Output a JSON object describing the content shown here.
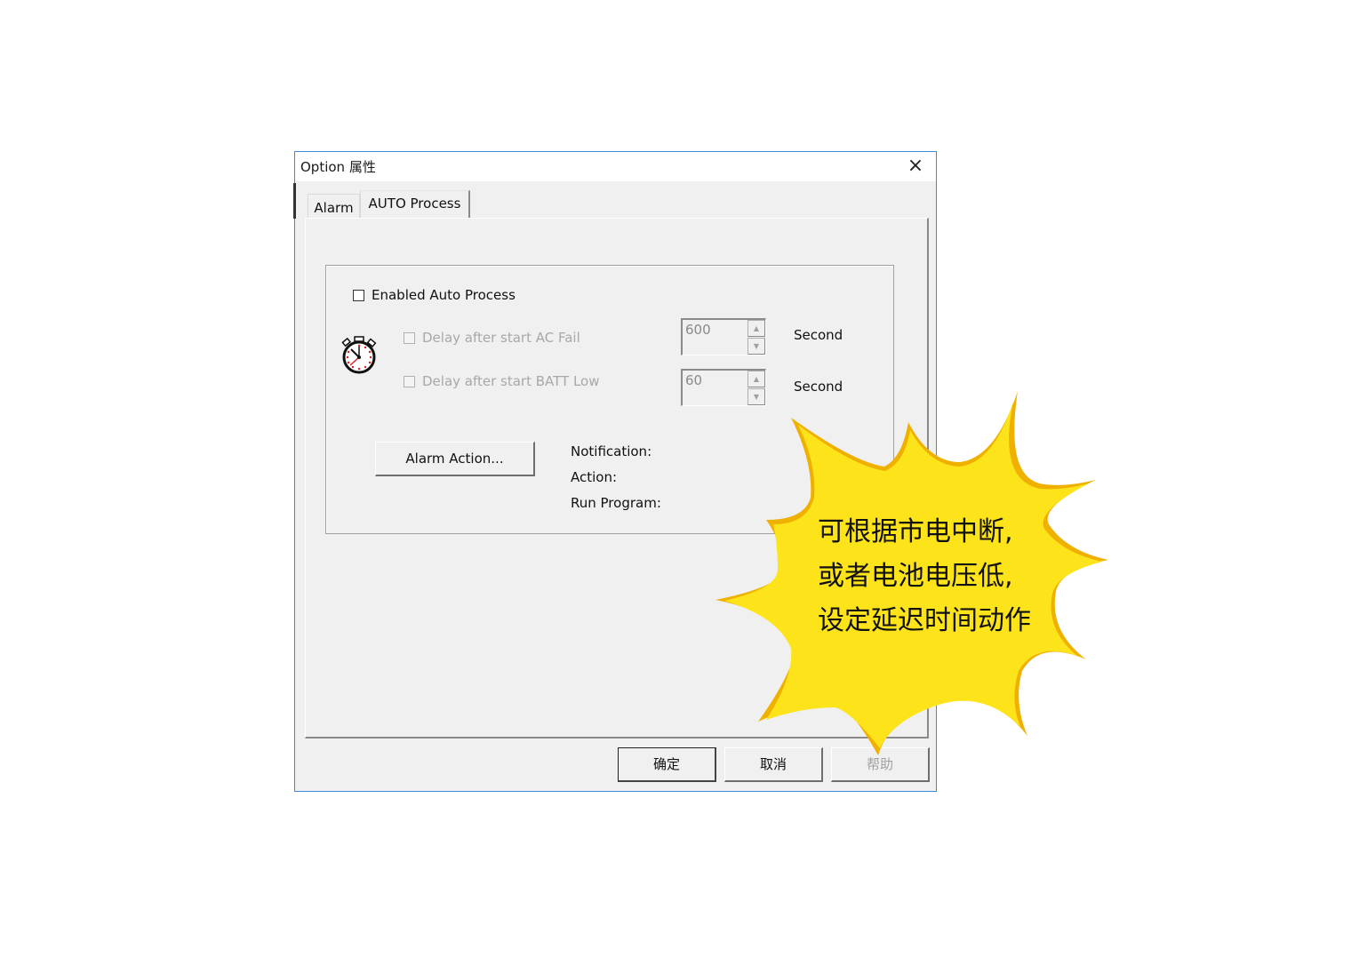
{
  "dialog": {
    "title": "Option 属性",
    "close_icon": "×",
    "tabs": [
      {
        "label": "Alarm",
        "active": false
      },
      {
        "label": "AUTO Process",
        "active": true
      }
    ]
  },
  "auto_process": {
    "enable_label": "Enabled Auto Process",
    "enable_checked": false,
    "timer_icon": "stopwatch-icon",
    "ac_fail": {
      "label": "Delay after start AC Fail",
      "checked": false,
      "enabled": false,
      "value": "600",
      "unit": "Second"
    },
    "batt_low": {
      "label": "Delay after start BATT Low",
      "checked": false,
      "enabled": false,
      "value": "60",
      "unit": "Second"
    },
    "alarm_action_button": "Alarm Action...",
    "info_labels": [
      "Notification:",
      "Action:",
      "Run Program:"
    ]
  },
  "footer": {
    "ok": "确定",
    "cancel": "取消",
    "help": "帮助"
  },
  "callout": {
    "lines": [
      "可根据市电中断,",
      "或者电池电压低,",
      "设定延迟时间动作"
    ],
    "fill_color": "#fde31a",
    "edge_color": "#f0b000"
  },
  "spinner": {
    "up": "▲",
    "down": "▼"
  }
}
